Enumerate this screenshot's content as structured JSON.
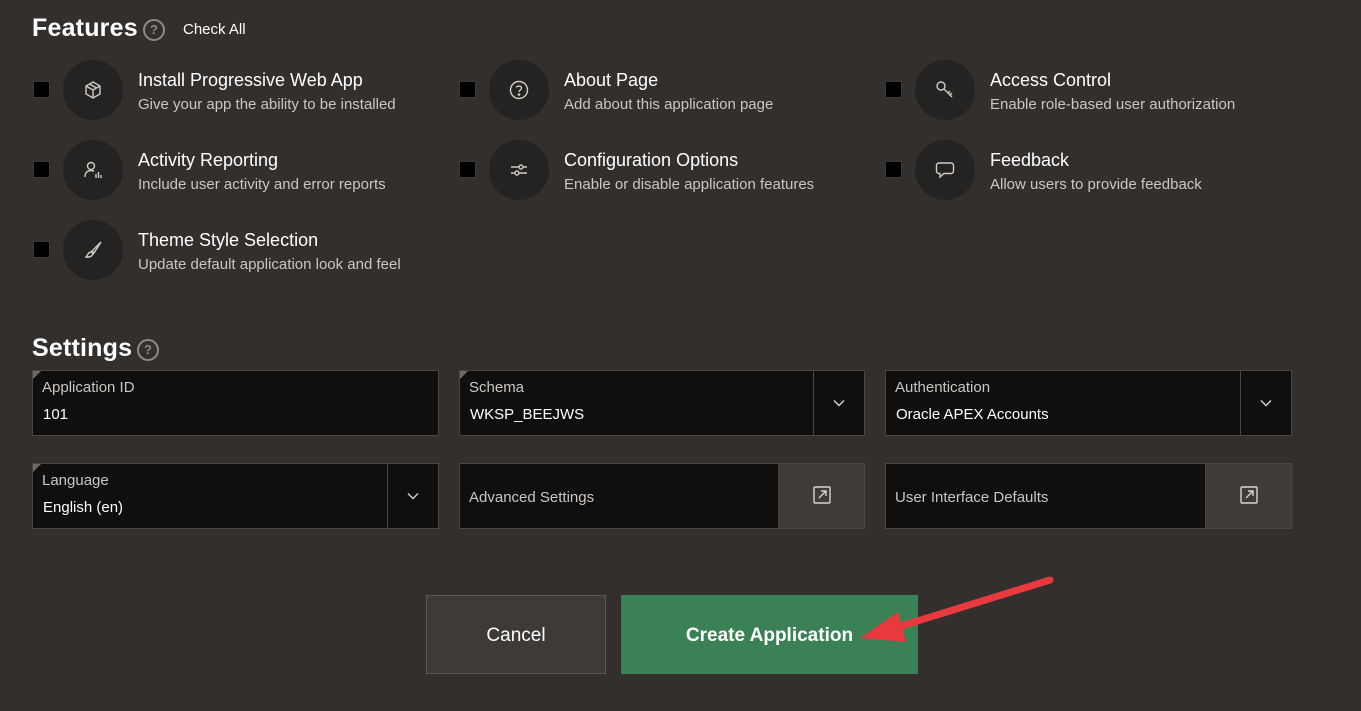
{
  "features": {
    "title": "Features",
    "check_all": "Check All",
    "items": [
      {
        "title": "Install Progressive Web App",
        "desc": "Give your app the ability to be installed",
        "icon": "cube-icon",
        "checked": false
      },
      {
        "title": "About Page",
        "desc": "Add about this application page",
        "icon": "question-circle-icon",
        "checked": false
      },
      {
        "title": "Access Control",
        "desc": "Enable role-based user authorization",
        "icon": "key-icon",
        "checked": false
      },
      {
        "title": "Activity Reporting",
        "desc": "Include user activity and error reports",
        "icon": "user-chart-icon",
        "checked": false
      },
      {
        "title": "Configuration Options",
        "desc": "Enable or disable application features",
        "icon": "sliders-icon",
        "checked": false
      },
      {
        "title": "Feedback",
        "desc": "Allow users to provide feedback",
        "icon": "comment-icon",
        "checked": false
      },
      {
        "title": "Theme Style Selection",
        "desc": "Update default application look and feel",
        "icon": "paintbrush-icon",
        "checked": false
      }
    ]
  },
  "settings": {
    "title": "Settings",
    "application_id": {
      "label": "Application ID",
      "value": "101"
    },
    "schema": {
      "label": "Schema",
      "value": "WKSP_BEEJWS"
    },
    "authentication": {
      "label": "Authentication",
      "value": "Oracle APEX Accounts"
    },
    "language": {
      "label": "Language",
      "value": "English (en)"
    },
    "advanced_settings": {
      "label": "Advanced Settings"
    },
    "ui_defaults": {
      "label": "User Interface Defaults"
    }
  },
  "actions": {
    "cancel": "Cancel",
    "create": "Create Application"
  },
  "colors": {
    "background": "#322f2d",
    "create_button": "#3a8255",
    "annotation_arrow": "#e8393f"
  }
}
